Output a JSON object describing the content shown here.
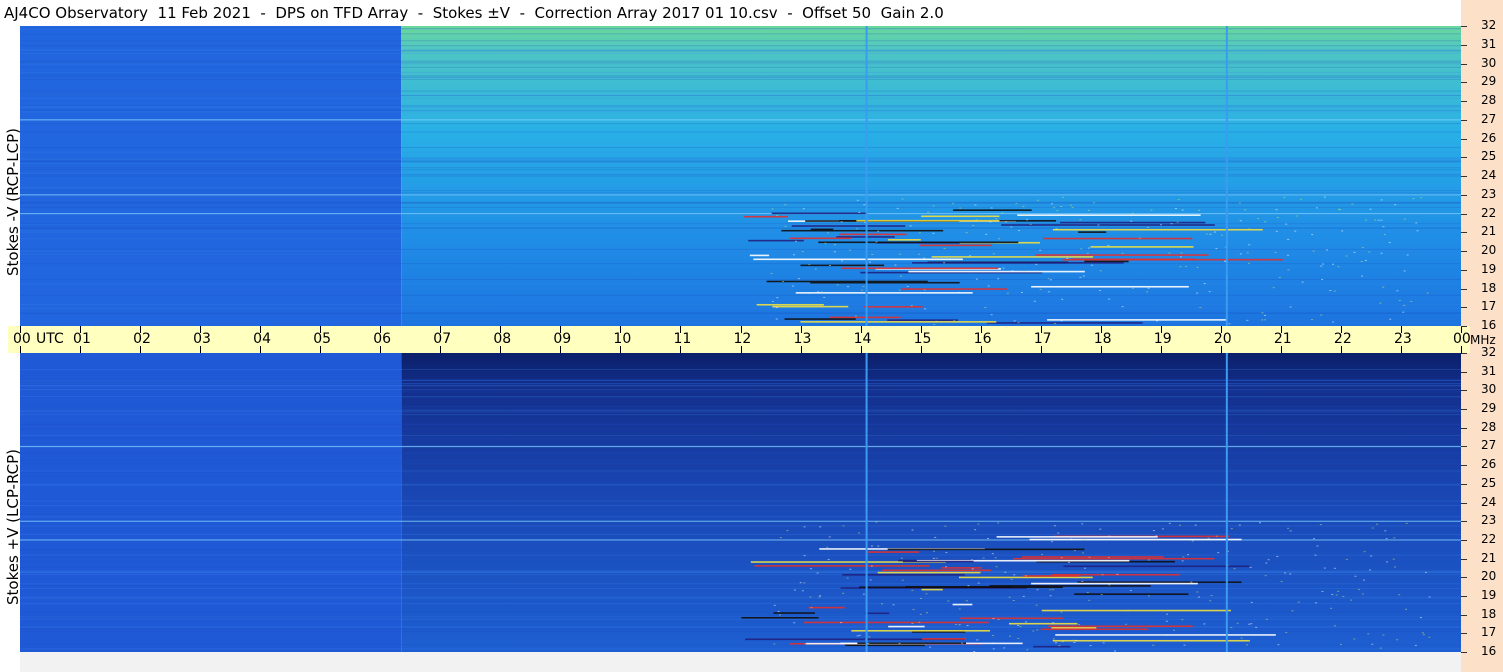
{
  "title": "AJ4CO Observatory  11 Feb 2021  -  DPS on TFD Array  -  Stokes ±V  -  Correction Array 2017 01 10.csv  -  Offset 50  Gain 2.0",
  "colors": {
    "background_quiet": "#1f63e2",
    "background_day_top": "#22a8e8",
    "background_day_bottom": "#1b45b8",
    "axis_band": "#ffffc0",
    "right_strip": "#fce0c8",
    "marker_line": "#3a9cf0"
  },
  "chart_data": [
    {
      "type": "heatmap",
      "panel": "top",
      "ylabel": "Stokes -V (RCP-LCP)",
      "y_unit": "MHz",
      "y_range": [
        16,
        32
      ],
      "y_ticks": [
        16,
        17,
        18,
        19,
        20,
        21,
        22,
        23,
        24,
        25,
        26,
        27,
        28,
        29,
        30,
        31,
        32
      ],
      "x_unit": "UTC",
      "x_range": [
        0,
        24
      ],
      "day_start_utc": 6.35,
      "marker_lines_utc": [
        14.1,
        20.1
      ],
      "band_lines_mhz": [
        27,
        23,
        22
      ]
    },
    {
      "type": "heatmap",
      "panel": "bottom",
      "ylabel": "Stokes +V (LCP-RCP)",
      "y_unit": "MHz",
      "y_range": [
        16,
        32
      ],
      "y_ticks": [
        16,
        17,
        18,
        19,
        20,
        21,
        22,
        23,
        24,
        25,
        26,
        27,
        28,
        29,
        30,
        31,
        32
      ],
      "x_unit": "UTC",
      "x_range": [
        0,
        24
      ],
      "day_start_utc": 6.35,
      "marker_lines_utc": [
        14.1,
        20.1
      ],
      "band_lines_mhz": [
        27,
        23,
        22
      ]
    }
  ],
  "x_axis": {
    "labels": [
      "00",
      "01",
      "02",
      "03",
      "04",
      "05",
      "06",
      "07",
      "08",
      "09",
      "10",
      "11",
      "12",
      "13",
      "14",
      "15",
      "16",
      "17",
      "18",
      "19",
      "20",
      "21",
      "22",
      "23",
      "00"
    ],
    "utc_label": "UTC",
    "mhz_label": "MHz"
  },
  "y_axis": {
    "top_label": "Stokes -V (RCP-LCP)",
    "bottom_label": "Stokes +V (LCP-RCP)",
    "ticks": [
      "32",
      "31",
      "30",
      "29",
      "28",
      "27",
      "26",
      "25",
      "24",
      "23",
      "22",
      "21",
      "20",
      "19",
      "18",
      "17",
      "16"
    ]
  }
}
